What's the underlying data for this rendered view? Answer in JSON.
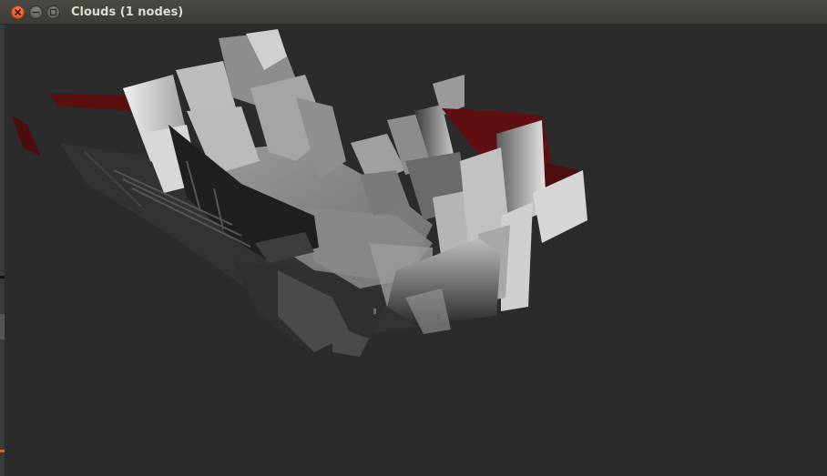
{
  "window": {
    "title": "Clouds (1 nodes)"
  },
  "titlebar_buttons": {
    "close": "close-icon",
    "minimize": "minimize-icon",
    "maximize": "maximize-icon"
  },
  "colors": {
    "viewport_background": "#2b2b2b",
    "titlebar": "#3c3b37",
    "close_button": "#e2562b",
    "point_cloud_red": "#6b1010"
  }
}
